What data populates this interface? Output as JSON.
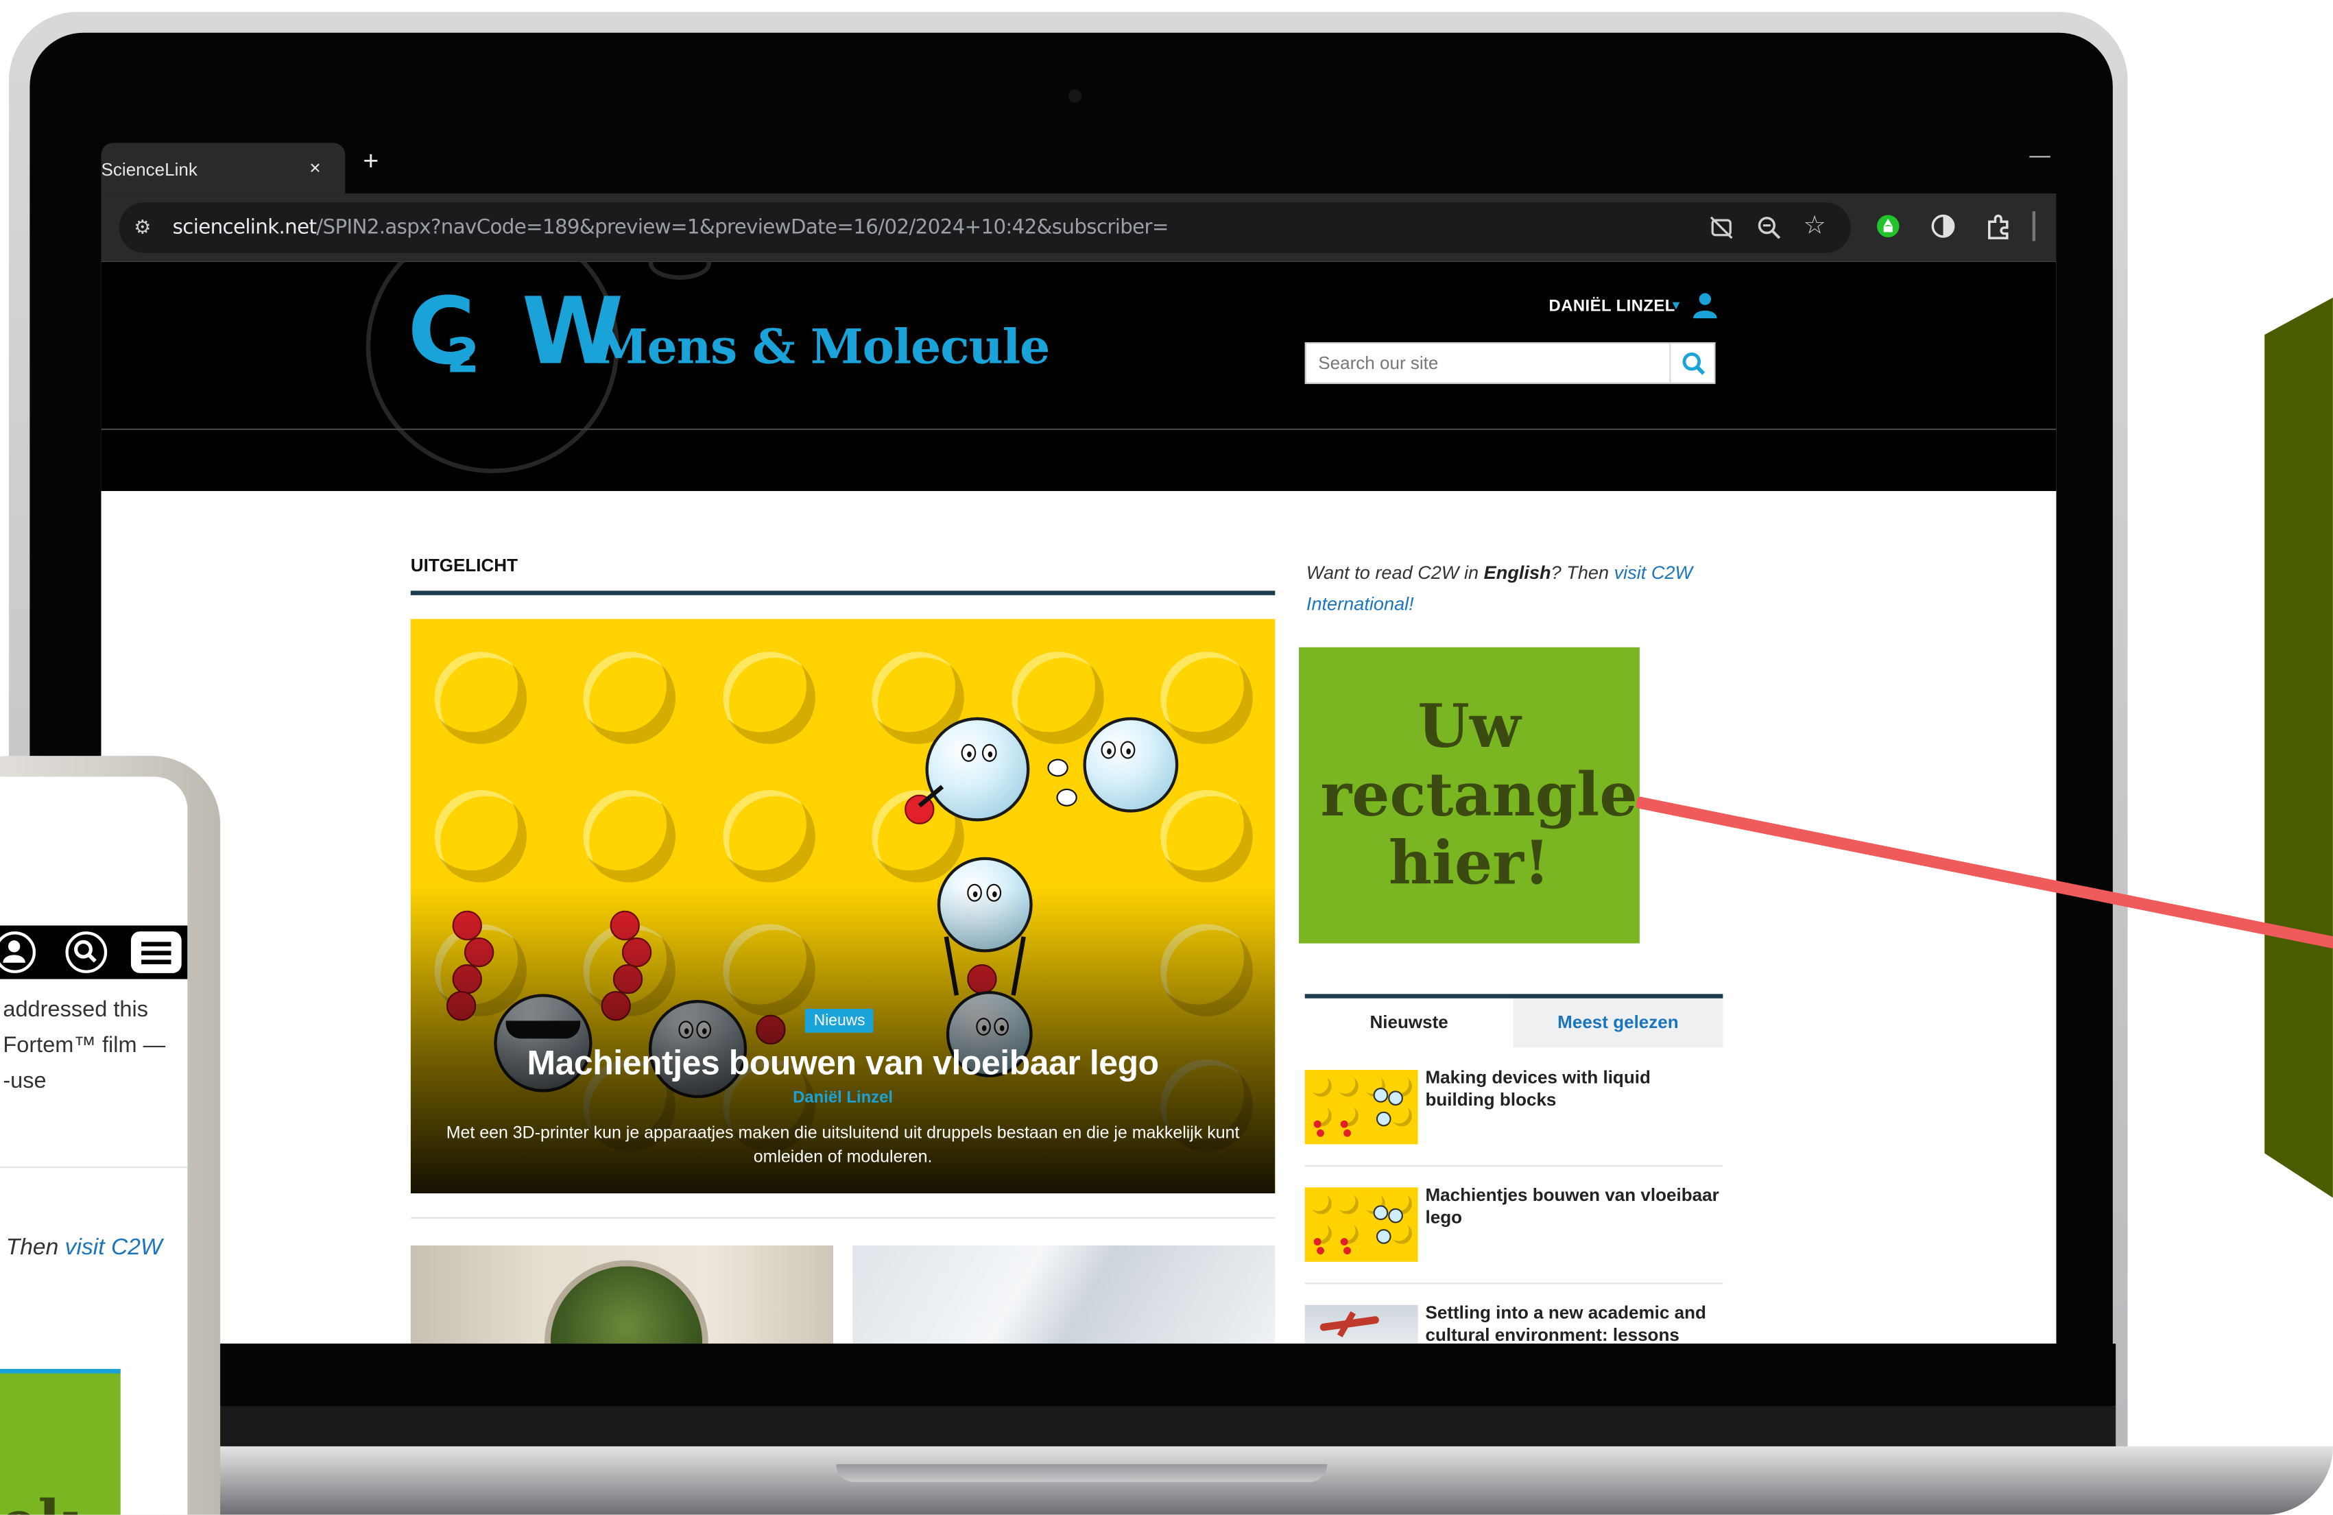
{
  "browser": {
    "tab_title": "ScienceLink",
    "tab_close": "×",
    "new_tab": "+",
    "minimize": "—",
    "url_domain": "sciencelink.net",
    "url_path": "/SPIN2.aspx?navCode=189&preview=1&previewDate=16/02/2024+10:42&subscriber=",
    "icons": [
      "site-info-icon",
      "eye-off-icon",
      "zoom-icon",
      "star-icon",
      "extension-green-icon",
      "contrast-icon",
      "puzzle-icon"
    ]
  },
  "header": {
    "logo_mark": "C",
    "logo_sub": "2",
    "logo_w": "W",
    "logo_title": "Mens & Molecule",
    "user_name": "DANIËL LINZEL",
    "user_caret": "▾",
    "search_placeholder": "Search our site"
  },
  "main": {
    "section_title": "UITGELICHT",
    "hero": {
      "badge": "Nieuws",
      "title": "Machientjes bouwen van vloeibaar lego",
      "author": "Daniël Linzel",
      "description": "Met een 3D-printer kun je apparaatjes maken die uitsluitend uit druppels bestaan en die je makkelijk kunt omleiden of moduleren."
    }
  },
  "sidebar": {
    "promo": {
      "prefix": "Want to read C2W in ",
      "bold": "English",
      "middle": "? Then ",
      "link": "visit C2W International!"
    },
    "ad_text": "Uw rectangle hier!",
    "ad_color": "#7ab622",
    "tabs": [
      {
        "label": "Nieuwste"
      },
      {
        "label": "Meest gelezen"
      }
    ],
    "news": [
      {
        "title": "Making devices with liquid building blocks"
      },
      {
        "title": "Machientjes bouwen van vloeibaar lego"
      },
      {
        "title": "Settling into a new academic and cultural environment: lessons"
      }
    ]
  },
  "phone": {
    "lines": [
      "addressed this",
      "Fortem™ film —",
      "-use"
    ],
    "promo_prefix": "Then ",
    "promo_link": "visit C2W",
    "ad_fragment": "ek"
  },
  "colors": {
    "accent": "#1aa3d8",
    "navy_rule": "#1d3b4f",
    "link": "#1b75bb",
    "ad_green": "#7ab622",
    "side_panel": "#4a5c00",
    "pointer": "#ef5a5a"
  }
}
